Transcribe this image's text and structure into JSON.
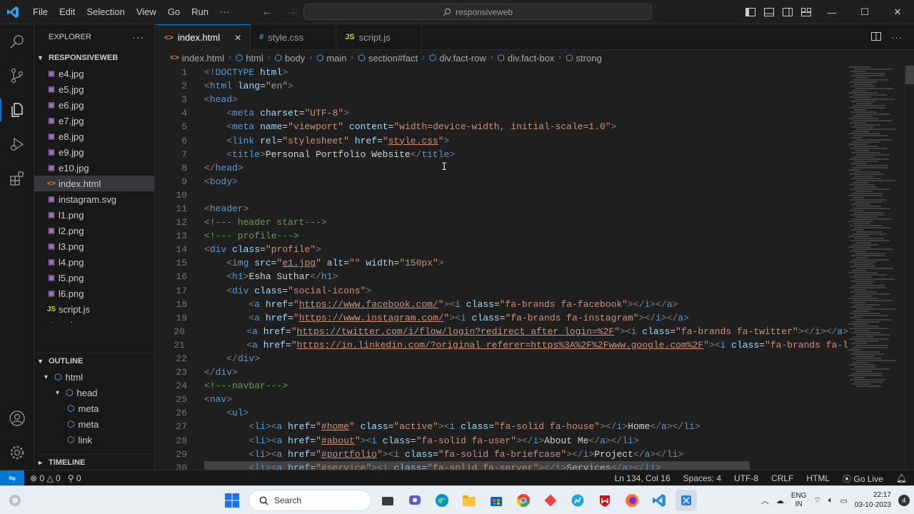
{
  "menu": [
    "File",
    "Edit",
    "Selection",
    "View",
    "Go",
    "Run",
    "···"
  ],
  "search": {
    "text": "responsiveweb"
  },
  "explorer": {
    "title": "EXPLORER",
    "folder": "RESPONSIVEWEB",
    "files": [
      {
        "name": "e4.jpg",
        "type": "img"
      },
      {
        "name": "e5.jpg",
        "type": "img"
      },
      {
        "name": "e6.jpg",
        "type": "img"
      },
      {
        "name": "e7.jpg",
        "type": "img"
      },
      {
        "name": "e8.jpg",
        "type": "img"
      },
      {
        "name": "e9.jpg",
        "type": "img"
      },
      {
        "name": "e10.jpg",
        "type": "img"
      },
      {
        "name": "index.html",
        "type": "html"
      },
      {
        "name": "instagram.svg",
        "type": "img"
      },
      {
        "name": "l1.png",
        "type": "img"
      },
      {
        "name": "l2.png",
        "type": "img"
      },
      {
        "name": "l3.png",
        "type": "img"
      },
      {
        "name": "l4.png",
        "type": "img"
      },
      {
        "name": "l5.png",
        "type": "img"
      },
      {
        "name": "l6.png",
        "type": "img"
      },
      {
        "name": "script.js",
        "type": "js"
      },
      {
        "name": "style.css",
        "type": "css"
      }
    ],
    "active_file": "index.html"
  },
  "outline": {
    "title": "OUTLINE",
    "items": [
      {
        "label": "html",
        "level": 0
      },
      {
        "label": "head",
        "level": 1
      },
      {
        "label": "meta",
        "level": 2
      },
      {
        "label": "meta",
        "level": 2
      },
      {
        "label": "link",
        "level": 2
      }
    ]
  },
  "timeline": {
    "title": "TIMELINE"
  },
  "tabs": [
    {
      "label": "index.html",
      "type": "html",
      "active": true
    },
    {
      "label": "style.css",
      "type": "css",
      "active": false
    },
    {
      "label": "script.js",
      "type": "js",
      "active": false
    }
  ],
  "breadcrumb": [
    "index.html",
    "html",
    "body",
    "main",
    "section#fact",
    "div.fact-row",
    "div.fact-box",
    "strong"
  ],
  "code_lines": [
    [
      [
        "t",
        "<!"
      ],
      [
        "n",
        "DOCTYPE"
      ],
      [
        "x",
        " "
      ],
      [
        "a",
        "html"
      ],
      [
        "t",
        ">"
      ]
    ],
    [
      [
        "t",
        "<"
      ],
      [
        "n",
        "html"
      ],
      [
        "x",
        " "
      ],
      [
        "a",
        "lang"
      ],
      [
        "x",
        "="
      ],
      [
        "s",
        "\"en\""
      ],
      [
        "t",
        ">"
      ]
    ],
    [
      [
        "t",
        "<"
      ],
      [
        "n",
        "head"
      ],
      [
        "t",
        ">"
      ]
    ],
    [
      [
        "x",
        "    "
      ],
      [
        "t",
        "<"
      ],
      [
        "n",
        "meta"
      ],
      [
        "x",
        " "
      ],
      [
        "a",
        "charset"
      ],
      [
        "x",
        "="
      ],
      [
        "s",
        "\"UTF-8\""
      ],
      [
        "t",
        ">"
      ]
    ],
    [
      [
        "x",
        "    "
      ],
      [
        "t",
        "<"
      ],
      [
        "n",
        "meta"
      ],
      [
        "x",
        " "
      ],
      [
        "a",
        "name"
      ],
      [
        "x",
        "="
      ],
      [
        "s",
        "\"viewport\""
      ],
      [
        "x",
        " "
      ],
      [
        "a",
        "content"
      ],
      [
        "x",
        "="
      ],
      [
        "s",
        "\"width=device-width, initial-scale=1.0\""
      ],
      [
        "t",
        ">"
      ]
    ],
    [
      [
        "x",
        "    "
      ],
      [
        "t",
        "<"
      ],
      [
        "n",
        "link"
      ],
      [
        "x",
        " "
      ],
      [
        "a",
        "rel"
      ],
      [
        "x",
        "="
      ],
      [
        "s",
        "\"stylesheet\""
      ],
      [
        "x",
        " "
      ],
      [
        "a",
        "href"
      ],
      [
        "x",
        "="
      ],
      [
        "s",
        "\""
      ],
      [
        "u",
        "style.css"
      ],
      [
        "s",
        "\""
      ],
      [
        "t",
        ">"
      ]
    ],
    [
      [
        "x",
        "    "
      ],
      [
        "t",
        "<"
      ],
      [
        "n",
        "title"
      ],
      [
        "t",
        ">"
      ],
      [
        "x",
        "Personal Portfolio Website"
      ],
      [
        "t",
        "</"
      ],
      [
        "n",
        "title"
      ],
      [
        "t",
        ">"
      ]
    ],
    [
      [
        "t",
        "</"
      ],
      [
        "n",
        "head"
      ],
      [
        "t",
        ">"
      ]
    ],
    [
      [
        "t",
        "<"
      ],
      [
        "n",
        "body"
      ],
      [
        "t",
        ">"
      ]
    ],
    [],
    [
      [
        "t",
        "<"
      ],
      [
        "n",
        "header"
      ],
      [
        "t",
        ">"
      ]
    ],
    [
      [
        "c",
        "<!--- header start--->"
      ]
    ],
    [
      [
        "c",
        "<!--- profile--->"
      ]
    ],
    [
      [
        "t",
        "<"
      ],
      [
        "n",
        "div"
      ],
      [
        "x",
        " "
      ],
      [
        "a",
        "class"
      ],
      [
        "x",
        "="
      ],
      [
        "s",
        "\"profile\""
      ],
      [
        "t",
        ">"
      ]
    ],
    [
      [
        "x",
        "    "
      ],
      [
        "t",
        "<"
      ],
      [
        "n",
        "img"
      ],
      [
        "x",
        " "
      ],
      [
        "a",
        "src"
      ],
      [
        "x",
        "="
      ],
      [
        "s",
        "\""
      ],
      [
        "u",
        "e1.jpg"
      ],
      [
        "s",
        "\""
      ],
      [
        "x",
        " "
      ],
      [
        "a",
        "alt"
      ],
      [
        "x",
        "="
      ],
      [
        "s",
        "\"\""
      ],
      [
        "x",
        " "
      ],
      [
        "a",
        "width"
      ],
      [
        "x",
        "="
      ],
      [
        "s",
        "\"150px\""
      ],
      [
        "t",
        ">"
      ]
    ],
    [
      [
        "x",
        "    "
      ],
      [
        "t",
        "<"
      ],
      [
        "n",
        "h1"
      ],
      [
        "t",
        ">"
      ],
      [
        "x",
        "Esha Suthar"
      ],
      [
        "t",
        "</"
      ],
      [
        "n",
        "h1"
      ],
      [
        "t",
        ">"
      ]
    ],
    [
      [
        "x",
        "    "
      ],
      [
        "t",
        "<"
      ],
      [
        "n",
        "div"
      ],
      [
        "x",
        " "
      ],
      [
        "a",
        "class"
      ],
      [
        "x",
        "="
      ],
      [
        "s",
        "\"social-icons\""
      ],
      [
        "t",
        ">"
      ]
    ],
    [
      [
        "x",
        "        "
      ],
      [
        "t",
        "<"
      ],
      [
        "n",
        "a"
      ],
      [
        "x",
        " "
      ],
      [
        "a",
        "href"
      ],
      [
        "x",
        "="
      ],
      [
        "s",
        "\""
      ],
      [
        "u",
        "https://www.facebook.com/"
      ],
      [
        "s",
        "\""
      ],
      [
        "t",
        "><"
      ],
      [
        "n",
        "i"
      ],
      [
        "x",
        " "
      ],
      [
        "a",
        "class"
      ],
      [
        "x",
        "="
      ],
      [
        "s",
        "\"fa-brands fa-facebook\""
      ],
      [
        "t",
        "></"
      ],
      [
        "n",
        "i"
      ],
      [
        "t",
        "></"
      ],
      [
        "n",
        "a"
      ],
      [
        "t",
        ">"
      ]
    ],
    [
      [
        "x",
        "        "
      ],
      [
        "t",
        "<"
      ],
      [
        "n",
        "a"
      ],
      [
        "x",
        " "
      ],
      [
        "a",
        "href"
      ],
      [
        "x",
        "="
      ],
      [
        "s",
        "\""
      ],
      [
        "u",
        "https://www.instagram.com/"
      ],
      [
        "s",
        "\""
      ],
      [
        "t",
        "><"
      ],
      [
        "n",
        "i"
      ],
      [
        "x",
        " "
      ],
      [
        "a",
        "class"
      ],
      [
        "x",
        "="
      ],
      [
        "s",
        "\"fa-brands fa-instagram\""
      ],
      [
        "t",
        "></"
      ],
      [
        "n",
        "i"
      ],
      [
        "t",
        "></"
      ],
      [
        "n",
        "a"
      ],
      [
        "t",
        ">"
      ]
    ],
    [
      [
        "x",
        "        "
      ],
      [
        "t",
        "<"
      ],
      [
        "n",
        "a"
      ],
      [
        "x",
        " "
      ],
      [
        "a",
        "href"
      ],
      [
        "x",
        "="
      ],
      [
        "s",
        "\""
      ],
      [
        "u",
        "https://twitter.com/i/flow/login?redirect_after_login=%2F"
      ],
      [
        "s",
        "\""
      ],
      [
        "t",
        "><"
      ],
      [
        "n",
        "i"
      ],
      [
        "x",
        " "
      ],
      [
        "a",
        "class"
      ],
      [
        "x",
        "="
      ],
      [
        "s",
        "\"fa-brands fa-twitter\""
      ],
      [
        "t",
        "></"
      ],
      [
        "n",
        "i"
      ],
      [
        "t",
        "></"
      ],
      [
        "n",
        "a"
      ],
      [
        "t",
        ">"
      ]
    ],
    [
      [
        "x",
        "        "
      ],
      [
        "t",
        "<"
      ],
      [
        "n",
        "a"
      ],
      [
        "x",
        " "
      ],
      [
        "a",
        "href"
      ],
      [
        "x",
        "="
      ],
      [
        "s",
        "\""
      ],
      [
        "u",
        "https://in.linkedin.com/?original_referer=https%3A%2F%2Fwww.google.com%2F"
      ],
      [
        "s",
        "\""
      ],
      [
        "t",
        "><"
      ],
      [
        "n",
        "i"
      ],
      [
        "x",
        " "
      ],
      [
        "a",
        "class"
      ],
      [
        "x",
        "="
      ],
      [
        "s",
        "\"fa-brands fa-l"
      ]
    ],
    [
      [
        "x",
        "    "
      ],
      [
        "t",
        "</"
      ],
      [
        "n",
        "div"
      ],
      [
        "t",
        ">"
      ]
    ],
    [
      [
        "t",
        "</"
      ],
      [
        "n",
        "div"
      ],
      [
        "t",
        ">"
      ]
    ],
    [
      [
        "c",
        "<!---navbar--->"
      ]
    ],
    [
      [
        "t",
        "<"
      ],
      [
        "n",
        "nav"
      ],
      [
        "t",
        ">"
      ]
    ],
    [
      [
        "x",
        "    "
      ],
      [
        "t",
        "<"
      ],
      [
        "n",
        "ul"
      ],
      [
        "t",
        ">"
      ]
    ],
    [
      [
        "x",
        "        "
      ],
      [
        "t",
        "<"
      ],
      [
        "n",
        "li"
      ],
      [
        "t",
        "><"
      ],
      [
        "n",
        "a"
      ],
      [
        "x",
        " "
      ],
      [
        "a",
        "href"
      ],
      [
        "x",
        "="
      ],
      [
        "s",
        "\""
      ],
      [
        "u",
        "#home"
      ],
      [
        "s",
        "\""
      ],
      [
        "x",
        " "
      ],
      [
        "a",
        "class"
      ],
      [
        "x",
        "="
      ],
      [
        "s",
        "\"active\""
      ],
      [
        "t",
        "><"
      ],
      [
        "n",
        "i"
      ],
      [
        "x",
        " "
      ],
      [
        "a",
        "class"
      ],
      [
        "x",
        "="
      ],
      [
        "s",
        "\"fa-solid fa-house\""
      ],
      [
        "t",
        "></"
      ],
      [
        "n",
        "i"
      ],
      [
        "t",
        ">"
      ],
      [
        "x",
        "Home"
      ],
      [
        "t",
        "</"
      ],
      [
        "n",
        "a"
      ],
      [
        "t",
        "></"
      ],
      [
        "n",
        "li"
      ],
      [
        "t",
        ">"
      ]
    ],
    [
      [
        "x",
        "        "
      ],
      [
        "t",
        "<"
      ],
      [
        "n",
        "li"
      ],
      [
        "t",
        "><"
      ],
      [
        "n",
        "a"
      ],
      [
        "x",
        " "
      ],
      [
        "a",
        "href"
      ],
      [
        "x",
        "="
      ],
      [
        "s",
        "\""
      ],
      [
        "u",
        "#about"
      ],
      [
        "s",
        "\""
      ],
      [
        "t",
        "><"
      ],
      [
        "n",
        "i"
      ],
      [
        "x",
        " "
      ],
      [
        "a",
        "class"
      ],
      [
        "x",
        "="
      ],
      [
        "s",
        "\"fa-solid fa-user\""
      ],
      [
        "t",
        "></"
      ],
      [
        "n",
        "i"
      ],
      [
        "t",
        ">"
      ],
      [
        "x",
        "About Me"
      ],
      [
        "t",
        "</"
      ],
      [
        "n",
        "a"
      ],
      [
        "t",
        "></"
      ],
      [
        "n",
        "li"
      ],
      [
        "t",
        ">"
      ]
    ],
    [
      [
        "x",
        "        "
      ],
      [
        "t",
        "<"
      ],
      [
        "n",
        "li"
      ],
      [
        "t",
        "><"
      ],
      [
        "n",
        "a"
      ],
      [
        "x",
        " "
      ],
      [
        "a",
        "href"
      ],
      [
        "x",
        "="
      ],
      [
        "s",
        "\""
      ],
      [
        "u",
        "#portfolio"
      ],
      [
        "s",
        "\""
      ],
      [
        "t",
        "><"
      ],
      [
        "n",
        "i"
      ],
      [
        "x",
        " "
      ],
      [
        "a",
        "class"
      ],
      [
        "x",
        "="
      ],
      [
        "s",
        "\"fa-solid fa-briefcase\""
      ],
      [
        "t",
        "></"
      ],
      [
        "n",
        "i"
      ],
      [
        "t",
        ">"
      ],
      [
        "x",
        "Project"
      ],
      [
        "t",
        "</"
      ],
      [
        "n",
        "a"
      ],
      [
        "t",
        "></"
      ],
      [
        "n",
        "li"
      ],
      [
        "t",
        ">"
      ]
    ],
    [
      [
        "x",
        "        "
      ],
      [
        "t",
        "<"
      ],
      [
        "n",
        "li"
      ],
      [
        "t",
        "><"
      ],
      [
        "n",
        "a"
      ],
      [
        "x",
        " "
      ],
      [
        "a",
        "href"
      ],
      [
        "x",
        "="
      ],
      [
        "s",
        "\""
      ],
      [
        "u",
        "#service"
      ],
      [
        "s",
        "\""
      ],
      [
        "t",
        "><"
      ],
      [
        "n",
        "i"
      ],
      [
        "x",
        " "
      ],
      [
        "a",
        "class"
      ],
      [
        "x",
        "="
      ],
      [
        "s",
        "\"fa-solid fa-server\""
      ],
      [
        "t",
        "></"
      ],
      [
        "n",
        "i"
      ],
      [
        "t",
        ">"
      ],
      [
        "x",
        "Services"
      ],
      [
        "t",
        "</"
      ],
      [
        "n",
        "a"
      ],
      [
        "t",
        "></"
      ],
      [
        "n",
        "li"
      ],
      [
        "t",
        ">"
      ]
    ]
  ],
  "status": {
    "errors": "0",
    "warnings": "0",
    "ports": "0",
    "position": "Ln 134, Col 16",
    "spaces": "Spaces: 4",
    "encoding": "UTF-8",
    "eol": "CRLF",
    "language": "HTML",
    "golive": "Go Live"
  },
  "taskbar": {
    "search_label": "Search",
    "lang_top": "ENG",
    "lang_bottom": "IN",
    "time": "22:17",
    "date": "03-10-2023"
  },
  "colors": {
    "accent": "#0078d4",
    "editor_bg": "#1f1f1f",
    "sidebar_bg": "#181818",
    "html_icon": "#e37933",
    "css_icon": "#519aba",
    "js_icon": "#cbcb41",
    "img_icon": "#a074c4"
  }
}
